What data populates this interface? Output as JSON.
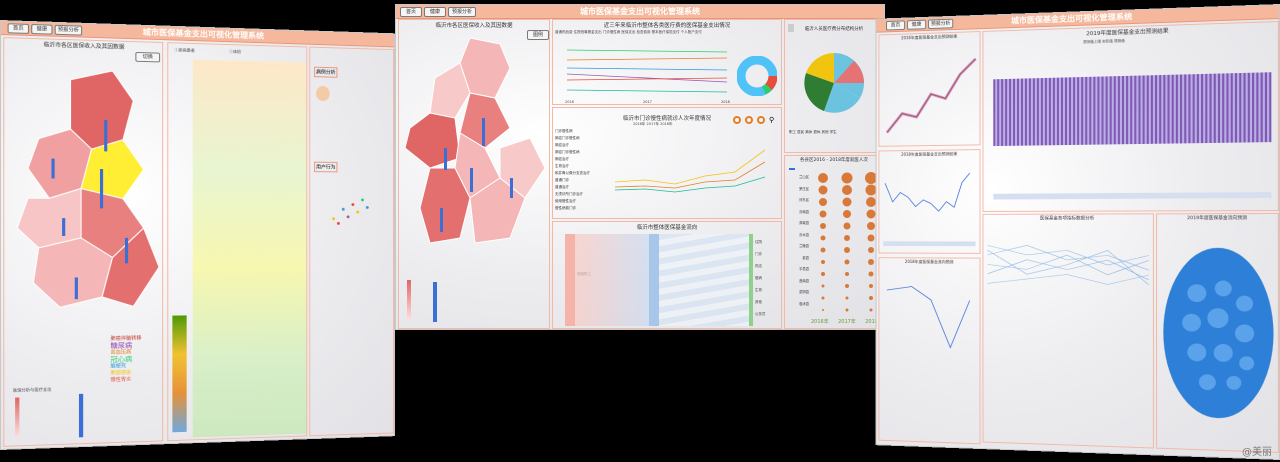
{
  "system_title": "城市医保基金支出可视化管理系统",
  "nav": [
    "首页",
    "健康",
    "预报分析"
  ],
  "left": {
    "map_title": "临沂市各区医保收入及其因数据",
    "legend_btn": "切换",
    "wordcloud": [
      "肺癌伴脑转移",
      "糖尿病",
      "高血压病",
      "冠心病",
      "脑梗死",
      "肺部感染",
      "慢性胃炎"
    ],
    "icon_tab1": "ⓘ疾病患者",
    "icon_tab2": "ⓘ体检",
    "person_panel_title": "病例分析",
    "person_panel_title2": "用户行为",
    "bottom_legend": "医保分析与医疗支出"
  },
  "center": {
    "map_title": "临沂市各区医保收入及其因数据",
    "map_btn": "图例",
    "line_title": "近三年来临沂市整体各类医疗费的医保基金支出情况",
    "line_legend": [
      "普通药品费",
      "住院统筹基金支出",
      "门诊慢性病",
      "医保支出",
      "检查费用",
      "基本医疗保险支付",
      "个人账户支付"
    ],
    "years": [
      "2016",
      "2017",
      "2018"
    ],
    "outpatient_title": "临沂市门诊慢性病就诊人次年度情况",
    "outpatient_legend": [
      "2016年",
      "2017年",
      "2018年"
    ],
    "disease_labels": [
      "门诊慢性病",
      "肺癌门诊慢性病",
      "肺癌治疗",
      "肺癌门诊慢性病",
      "肺癌治疗",
      "生育治疗",
      "和并骨以像分支查治疗",
      "普通门诊",
      "普通治疗",
      "无须诊所门诊治疗",
      "使用慢性治疗",
      "慢性病费门诊"
    ],
    "sankey_title": "临沂市整体医保基金流向",
    "sankey_left": "城镇职工",
    "sankey_right": [
      "住院",
      "门诊",
      "药店",
      "慢病",
      "生育",
      "其他",
      "公务员"
    ],
    "pie_title": "临沂人员医疗费分布结构分析",
    "pie_legend": [
      "职工",
      "居民",
      "离休",
      "退休",
      "其他",
      "学生"
    ],
    "pie_labels": [
      "普通门诊1.9%",
      "住院56.3%",
      "慢病22.6%",
      "药店9.8%",
      "其他3.4%",
      "生育1.1%"
    ],
    "bubble_title": "各县区2016 - 2018年度就医人次",
    "counties": [
      "兰山区",
      "罗庄区",
      "河东区",
      "沂南县",
      "郯城县",
      "沂水县",
      "兰陵县",
      "费县",
      "平邑县",
      "莒南县",
      "蒙阴县",
      "临沭县"
    ],
    "bubble_years": [
      "2016年",
      "2017年",
      "2018年"
    ]
  },
  "right": {
    "chart1_title": "2016年度医保基金支出预测结果",
    "chart2_title": "2019年度医保基金支出预测结果",
    "chart2_legend": [
      "预测值上限",
      "实际值",
      "预测值"
    ],
    "chart3_title": "2018年度医保基金支出预测结果",
    "chart4_title": "医保基金各项指标数据分析",
    "chart5_title": "2018年度医保基金流向预测",
    "chart6_title": "2019年度医保基金流向预测"
  },
  "watermark": "@美丽",
  "colors": {
    "topbar": "#f6b89c",
    "accent": "#e9957a",
    "map_red": "#e06666",
    "map_pink": "#f4b6b6",
    "map_yellow": "#ffee33",
    "blue": "#3b6fd6",
    "bubble": "#d8793a"
  }
}
